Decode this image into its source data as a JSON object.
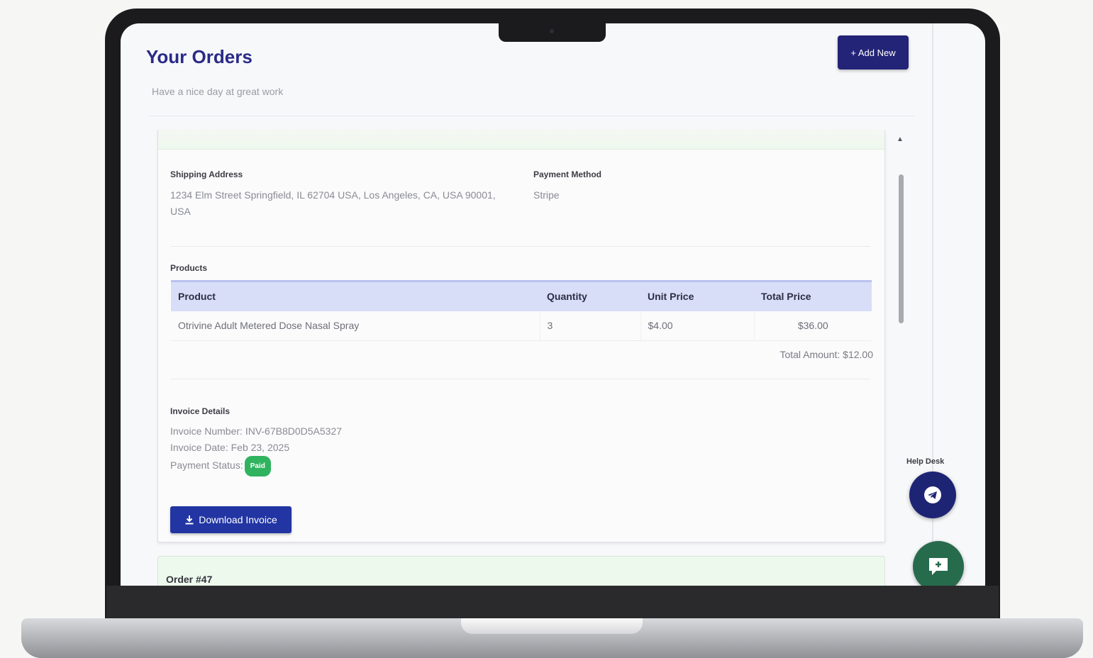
{
  "header": {
    "title": "Your Orders",
    "subtitle": "Have a nice day at great work",
    "add_new_label": "+ Add New"
  },
  "order": {
    "shipping_label": "Shipping Address",
    "shipping_address": "1234 Elm Street Springfield, IL 62704 USA, Los Angeles, CA, USA 90001, USA",
    "payment_label": "Payment Method",
    "payment_method": "Stripe",
    "products_label": "Products",
    "columns": [
      "Product",
      "Quantity",
      "Unit Price",
      "Total Price"
    ],
    "items": [
      {
        "product": "Otrivine Adult Metered Dose Nasal Spray",
        "quantity": "3",
        "unit_price": "$4.00",
        "total_price": "$36.00"
      }
    ],
    "total_amount": "Total Amount: $12.00",
    "invoice_label": "Invoice Details",
    "invoice_number": "Invoice Number: INV-67B8D0D5A5327",
    "invoice_date": "Invoice Date: Feb 23, 2025",
    "payment_status_label": "Payment Status:",
    "payment_status": "Paid",
    "download_label": "Download Invoice"
  },
  "next_order": {
    "title": "Order #47"
  },
  "widgets": {
    "help_desk_label": "Help Desk"
  },
  "colors": {
    "brand": "#232377",
    "title": "#2a2b86",
    "download": "#2235a3",
    "paid": "#2fb35f",
    "table_header": "#d8def7",
    "chat": "#276b4d"
  },
  "icons": {
    "help_desk": "telegram-icon",
    "chat": "chat-icon",
    "download": "download-icon"
  }
}
